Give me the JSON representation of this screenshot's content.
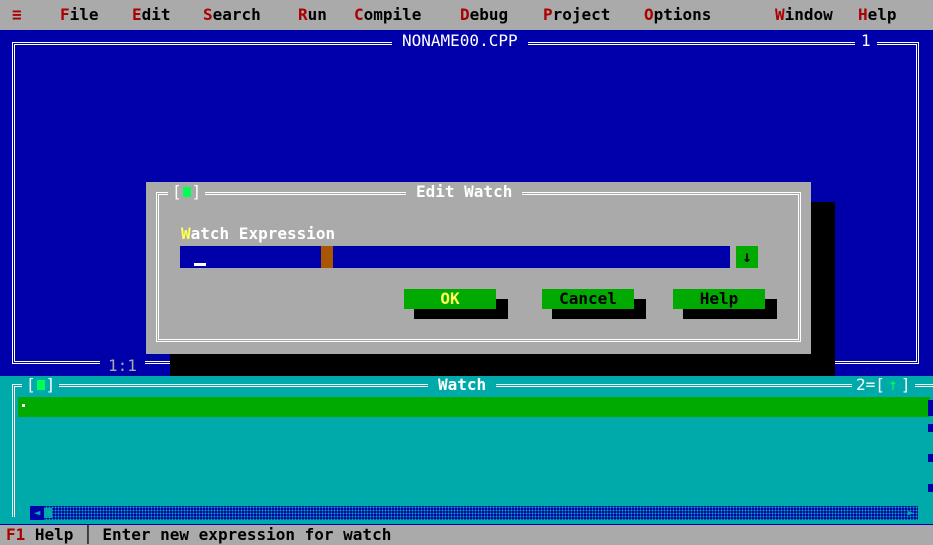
{
  "menu": {
    "system_icon": "≡",
    "items": [
      {
        "hotkey": "F",
        "rest": "ile"
      },
      {
        "hotkey": "E",
        "rest": "dit"
      },
      {
        "hotkey": "S",
        "rest": "earch"
      },
      {
        "hotkey": "R",
        "rest": "un"
      },
      {
        "hotkey": "C",
        "rest": "ompile"
      },
      {
        "hotkey": "D",
        "rest": "ebug"
      },
      {
        "hotkey": "P",
        "rest": "roject"
      },
      {
        "hotkey": "O",
        "rest": "ptions"
      },
      {
        "hotkey": "W",
        "rest": "indow"
      },
      {
        "hotkey": "H",
        "rest": "elp"
      }
    ]
  },
  "editor": {
    "title": "NONAME00.CPP",
    "window_number": "1",
    "cursor_position": "1:1"
  },
  "dialog": {
    "title": "Edit Watch",
    "close_open": "[",
    "close_close": "]",
    "field_label_hotkey": "W",
    "field_label_rest": "atch Expression",
    "field_value": "",
    "history_arrow": "↓",
    "buttons": {
      "ok": "OK",
      "cancel": "Cancel",
      "help": "Help"
    }
  },
  "watch_window": {
    "title": "Watch",
    "close_open": "[",
    "close_close": "]",
    "window_number": "2",
    "zoom_arrow": "↑"
  },
  "status": {
    "key": "F1",
    "key_label": " Help",
    "separator": " │ ",
    "message": "Enter new expression for watch"
  },
  "colors": {
    "desktop": "#0000aa",
    "menu_bg": "#aaaaaa",
    "hotkey": "#aa0000",
    "dialog_bg": "#aaaaaa",
    "button_bg": "#00aa00",
    "default_button_text": "#ffff55",
    "watch_bg": "#00aaaa",
    "watch_row": "#00aa00"
  }
}
